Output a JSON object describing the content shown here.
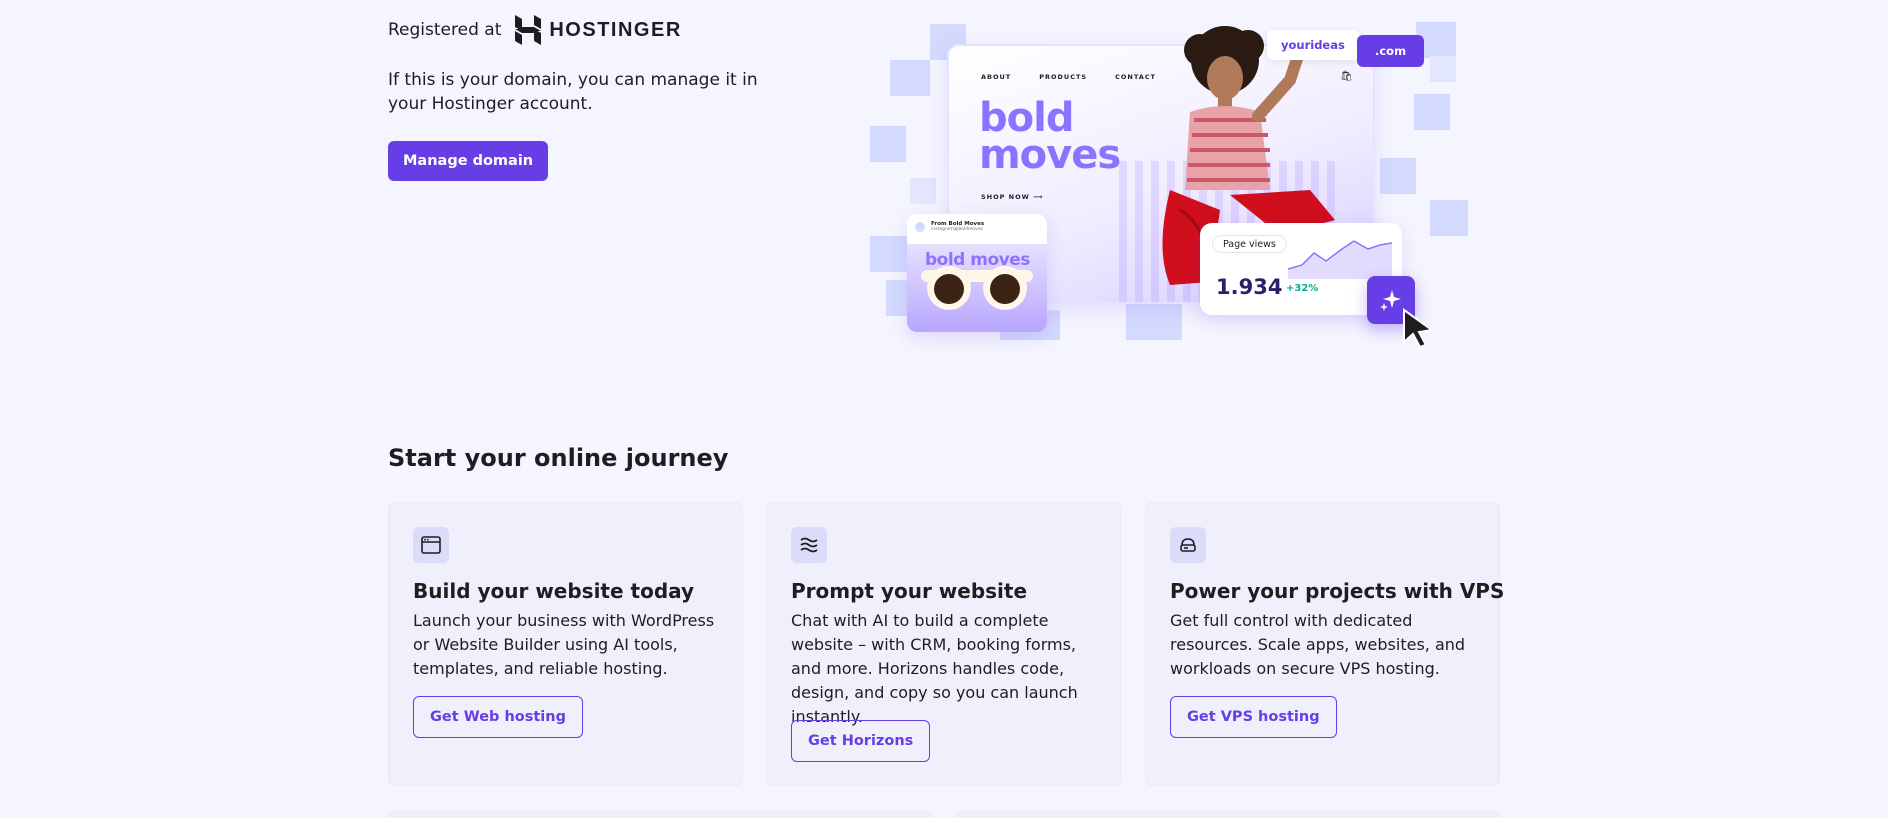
{
  "registration": {
    "label": "Registered at",
    "registrar_name": "HOSTINGER",
    "manage_text": "If this is your domain, you can manage it in your Hostinger account.",
    "manage_button": "Manage domain"
  },
  "hero": {
    "nav_items": [
      "ABOUT",
      "PRODUCTS",
      "CONTACT"
    ],
    "headline_line1": "bold",
    "headline_line2": "moves",
    "shop_now": "SHOP NOW ⟶",
    "domain_name": "yourideas",
    "domain_tld": ".com",
    "mini_card_title": "From Bold Moves",
    "mini_card_sub": "instagram@boldmoves",
    "mini_card_text": "bold moves",
    "stats_label": "Page views",
    "stats_value": "1.934",
    "stats_delta": "+32%"
  },
  "journey": {
    "title": "Start your online journey",
    "cards": [
      {
        "icon": "browser-window-icon",
        "title": "Build your website today",
        "description": "Launch your business with WordPress or Website Builder using AI tools, templates, and reliable hosting.",
        "button": "Get Web hosting"
      },
      {
        "icon": "horizons-waves-icon",
        "title": "Prompt your website",
        "description": "Chat with AI to build a complete website – with CRM, booking forms, and more. Horizons handles code, design, and copy so you can launch instantly.",
        "button": "Get Horizons"
      },
      {
        "icon": "cloud-server-icon",
        "title": "Power your projects with VPS",
        "description": "Get full control with dedicated resources. Scale apps, websites, and workloads on secure VPS hosting.",
        "button": "Get VPS hosting"
      }
    ]
  },
  "colors": {
    "accent": "#673de6",
    "background": "#f4f5ff",
    "card_background": "#eff0fc",
    "text": "#1d1e20",
    "positive": "#00b090"
  }
}
